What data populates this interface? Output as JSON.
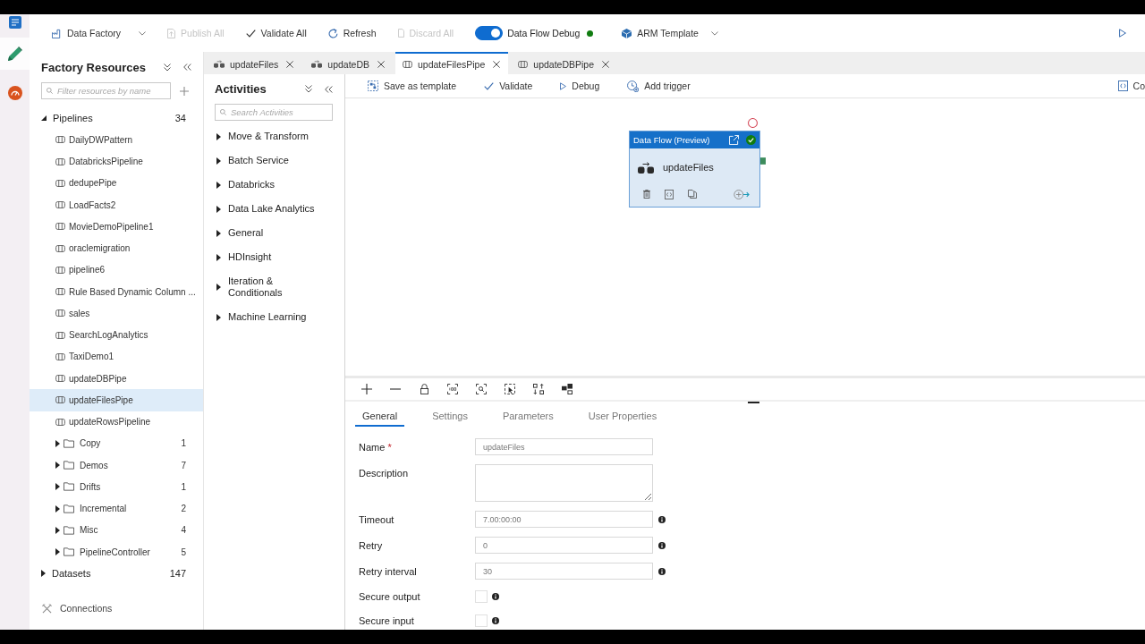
{
  "rail": {
    "items": [
      {
        "kind": "app",
        "selected": false
      },
      {
        "kind": "author",
        "selected": true
      },
      {
        "kind": "monitor",
        "selected": false
      }
    ]
  },
  "toolbar": {
    "factory": {
      "label": "Data Factory"
    },
    "actions": [
      {
        "kind": "publish",
        "label": "Publish All",
        "disabled": true
      },
      {
        "kind": "validate",
        "label": "Validate All",
        "disabled": false
      },
      {
        "kind": "refresh",
        "label": "Refresh",
        "disabled": false
      },
      {
        "kind": "discard",
        "label": "Discard All",
        "disabled": true
      }
    ],
    "debug": {
      "label": "Data Flow Debug",
      "on": true,
      "session_ready": true
    },
    "arm": {
      "label": "ARM Template"
    }
  },
  "sidebar": {
    "title": "Factory Resources",
    "search": {
      "placeholder": "Filter resources by name"
    },
    "tree": [
      {
        "kind": "group",
        "label": "Pipelines",
        "count": "34",
        "expanded": true,
        "selected": false,
        "children": [
          {
            "kind": "pipeline",
            "label": "DailyDWPattern",
            "selected": false
          },
          {
            "kind": "pipeline",
            "label": "DatabricksPipeline",
            "selected": false
          },
          {
            "kind": "pipeline",
            "label": "dedupePipe",
            "selected": false
          },
          {
            "kind": "pipeline",
            "label": "LoadFacts2",
            "selected": false
          },
          {
            "kind": "pipeline",
            "label": "MovieDemoPipeline1",
            "selected": false
          },
          {
            "kind": "pipeline",
            "label": "oraclemigration",
            "selected": false
          },
          {
            "kind": "pipeline",
            "label": "pipeline6",
            "selected": false
          },
          {
            "kind": "pipeline",
            "label": "Rule Based Dynamic Column ...",
            "selected": false
          },
          {
            "kind": "pipeline",
            "label": "sales",
            "selected": false
          },
          {
            "kind": "pipeline",
            "label": "SearchLogAnalytics",
            "selected": false
          },
          {
            "kind": "pipeline",
            "label": "TaxiDemo1",
            "selected": false
          },
          {
            "kind": "pipeline",
            "label": "updateDBPipe",
            "selected": false
          },
          {
            "kind": "pipeline",
            "label": "updateFilesPipe",
            "selected": true
          },
          {
            "kind": "pipeline",
            "label": "updateRowsPipeline",
            "selected": false
          },
          {
            "kind": "folder",
            "label": "Copy",
            "count": "1",
            "expanded": false,
            "selected": false
          },
          {
            "kind": "folder",
            "label": "Demos",
            "count": "7",
            "expanded": false,
            "selected": false
          },
          {
            "kind": "folder",
            "label": "Drifts",
            "count": "1",
            "expanded": false,
            "selected": false
          },
          {
            "kind": "folder",
            "label": "Incremental",
            "count": "2",
            "expanded": false,
            "selected": false
          },
          {
            "kind": "folder",
            "label": "Misc",
            "count": "4",
            "expanded": false,
            "selected": false
          },
          {
            "kind": "folder",
            "label": "PipelineController",
            "count": "5",
            "expanded": false,
            "selected": false
          }
        ]
      },
      {
        "kind": "group",
        "label": "Datasets",
        "count": "147",
        "expanded": false,
        "selected": false
      }
    ],
    "footer": {
      "label": "Connections"
    }
  },
  "tabs": [
    {
      "kind": "dataflow",
      "label": "updateFiles",
      "selected": false
    },
    {
      "kind": "dataflow",
      "label": "updateDB",
      "selected": false
    },
    {
      "kind": "pipeline",
      "label": "updateFilesPipe",
      "selected": true
    },
    {
      "kind": "pipeline",
      "label": "updateDBPipe",
      "selected": false
    }
  ],
  "activities": {
    "title": "Activities",
    "search": {
      "placeholder": "Search Activities"
    },
    "groups": [
      {
        "label": "Move & Transform",
        "expanded": false
      },
      {
        "label": "Batch Service",
        "expanded": false
      },
      {
        "label": "Databricks",
        "expanded": false
      },
      {
        "label": "Data Lake Analytics",
        "expanded": false
      },
      {
        "label": "General",
        "expanded": false
      },
      {
        "label": "HDInsight",
        "expanded": false
      },
      {
        "label": "Iteration & Conditionals",
        "expanded": false
      },
      {
        "label": "Machine Learning",
        "expanded": false
      }
    ]
  },
  "canvas_toolbar": {
    "actions": [
      {
        "kind": "template",
        "label": "Save as template"
      },
      {
        "kind": "validate",
        "label": "Validate"
      },
      {
        "kind": "debug",
        "label": "Debug"
      },
      {
        "kind": "trigger",
        "label": "Add trigger"
      },
      {
        "kind": "code",
        "label": "Co"
      }
    ]
  },
  "canvas": {
    "nodes": [
      {
        "type": "Data Flow (Preview)",
        "name": "updateFiles",
        "validated": true
      }
    ]
  },
  "properties": {
    "tabs": [
      {
        "label": "General",
        "selected": true
      },
      {
        "label": "Settings",
        "selected": false
      },
      {
        "label": "Parameters",
        "selected": false
      },
      {
        "label": "User Properties",
        "selected": false
      }
    ],
    "required_mark": "*",
    "fields": [
      {
        "kind": "text",
        "label": "Name",
        "required": true,
        "info": false,
        "value": "updateFiles"
      },
      {
        "kind": "textarea",
        "label": "Description",
        "required": false,
        "info": false
      },
      {
        "kind": "text",
        "label": "Timeout",
        "required": false,
        "info": true,
        "value": "7.00:00:00"
      },
      {
        "kind": "text",
        "label": "Retry",
        "required": false,
        "info": true,
        "value": "0"
      },
      {
        "kind": "text",
        "label": "Retry interval",
        "required": false,
        "info": true,
        "value": "30"
      },
      {
        "kind": "checkbox",
        "label": "Secure output",
        "required": false,
        "info": true,
        "checked": false
      },
      {
        "kind": "checkbox",
        "label": "Secure input",
        "required": false,
        "info": true,
        "checked": false
      }
    ]
  }
}
